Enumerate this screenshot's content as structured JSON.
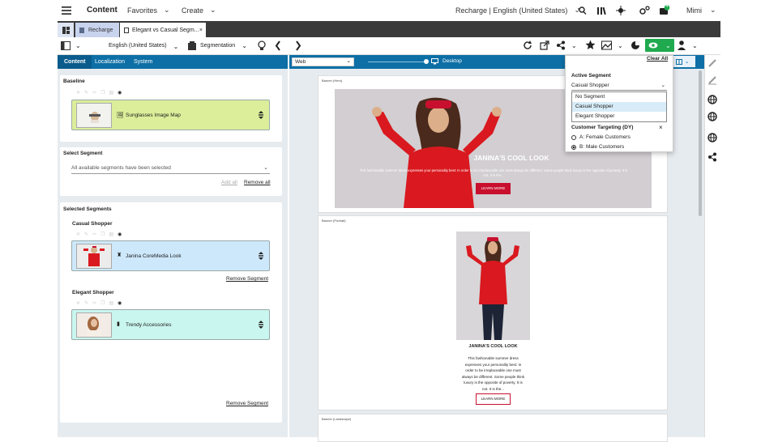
{
  "topbar": {
    "app_title": "Content",
    "favorites": "Favorites",
    "create": "Create",
    "site_selector": "Recharge | English (United States)",
    "user": "Mimi",
    "notification_count": "4"
  },
  "tabs": [
    {
      "label": "Recharge"
    },
    {
      "label": "Elegant vs Casual Segm..."
    }
  ],
  "toolbar": {
    "locale": "English (United States)",
    "segmentation": "Segmentation"
  },
  "left": {
    "subtabs": [
      "Content",
      "Localization",
      "System"
    ],
    "baseline_title": "Baseline",
    "baseline_item": "Sunglasses Image Map",
    "select_segment_title": "Select Segment",
    "select_placeholder": "All available segments have been selected",
    "add_all": "Add all",
    "remove_all": "Remove all",
    "selected_segments_title": "Selected Segments",
    "segments": [
      {
        "name": "Casual Shopper",
        "item": "Janina CoreMedia Look",
        "remove": "Remove Segment"
      },
      {
        "name": "Elegant Shopper",
        "item": "Trendy Accessories",
        "remove": "Remove Segment"
      }
    ]
  },
  "preview": {
    "channel": "Web",
    "device": "Desktop",
    "banner1_caption": "Banner (Hero)",
    "banner2_caption": "Banner (Portrait)",
    "banner3_caption": "Banner (Landscape)",
    "hero_title": "JANINA'S COOL LOOK",
    "hero_text": "This fashionable summer dress expresses your personality best: In order to be irreplaceable one must always be different. Some people think luxury is the opposite of poverty. It is not. It is the...",
    "hero_button": "LEARN MORE",
    "portrait_title": "JANINA'S COOL LOOK",
    "portrait_text_lines": [
      "This fashionable summer dress",
      "expresses your personality best: In",
      "order to be irreplaceable one must",
      "always be different. Some people think",
      "luxury is the opposite of poverty. It is",
      "not. It is the..."
    ],
    "portrait_button": "LEARN MORE"
  },
  "segpanel": {
    "clear_all": "Clear All",
    "active_segment_label": "Active Segment",
    "active_segment_value": "Casual Shopper",
    "options": [
      "No Segment",
      "Casual Shopper",
      "Elegant Shopper"
    ],
    "targeting_label": "Customer Targeting (DY)",
    "radio_a": "A: Female Customers",
    "radio_b": "B: Male Customers",
    "selected_option": "Casual Shopper",
    "selected_radio": "B: Male Customers"
  },
  "colors": {
    "accent": "#0d6fa6",
    "baseline_slot": "#dcee9a",
    "casual_slot": "#cde8fb",
    "elegant_slot": "#c9f6ee",
    "segment_button": "#1faa4f",
    "hero_button": "#c8102e"
  }
}
